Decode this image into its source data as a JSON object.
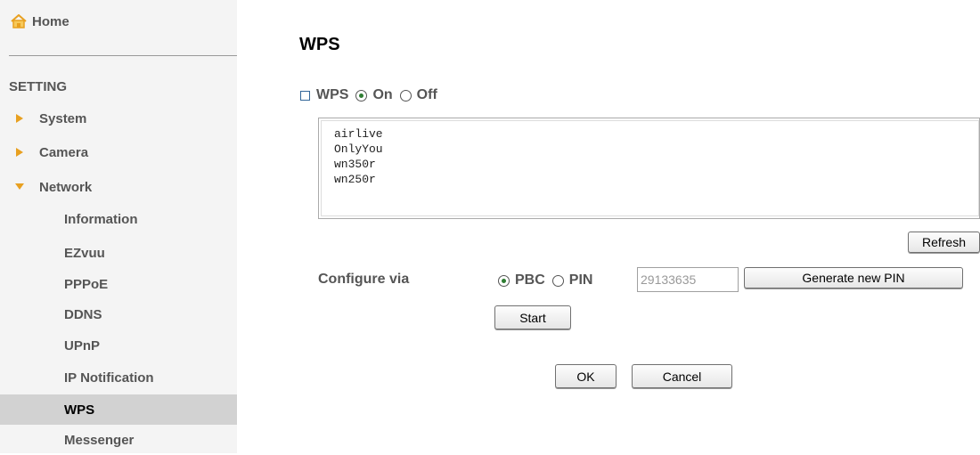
{
  "sidebar": {
    "home_label": "Home",
    "section_title": "SETTING",
    "items": [
      {
        "label": "System",
        "expanded": false
      },
      {
        "label": "Camera",
        "expanded": false
      },
      {
        "label": "Network",
        "expanded": true
      }
    ],
    "network_subitems": [
      {
        "label": "Information"
      },
      {
        "label": "EZvuu"
      },
      {
        "label": "PPPoE"
      },
      {
        "label": "DDNS"
      },
      {
        "label": "UPnP"
      },
      {
        "label": "IP Notification"
      },
      {
        "label": "WPS",
        "active": true
      },
      {
        "label": "Messenger"
      }
    ]
  },
  "main": {
    "title": "WPS",
    "wps_toggle": {
      "label": "WPS",
      "on_label": "On",
      "off_label": "Off",
      "selected": "On"
    },
    "ssid_list": [
      "airlive",
      "OnlyYou",
      "wn350r",
      "wn250r"
    ],
    "refresh_label": "Refresh",
    "configure": {
      "label": "Configure via",
      "pbc_label": "PBC",
      "pin_label": "PIN",
      "selected": "PBC",
      "pin_value": "29133635",
      "generate_pin_label": "Generate new PIN",
      "start_label": "Start"
    },
    "ok_label": "OK",
    "cancel_label": "Cancel"
  },
  "colors": {
    "sidebar_bg": "#f4f4f4",
    "active_item_bg": "#d2d2d2",
    "arrow_color": "#e8a020",
    "home_icon_color": "#e8a020",
    "radio_selected": "#2e7d32"
  }
}
